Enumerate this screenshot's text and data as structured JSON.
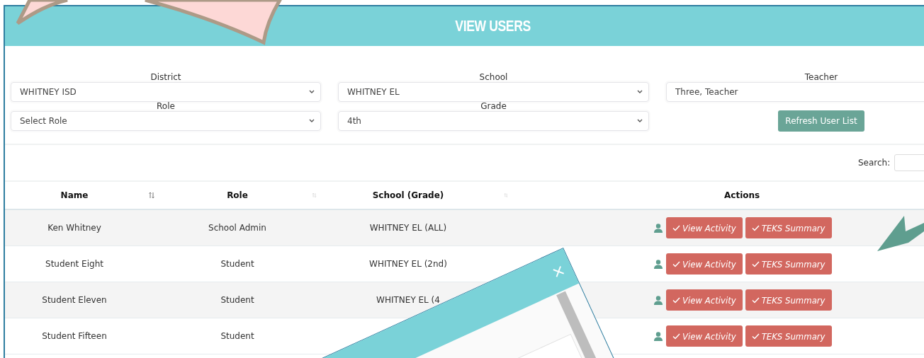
{
  "header": {
    "title": "VIEW USERS"
  },
  "filters": [
    {
      "label": "District",
      "value": "WHITNEY ISD",
      "kind": "select"
    },
    {
      "label": "School",
      "value": "WHITNEY EL",
      "kind": "select"
    },
    {
      "label": "Teacher",
      "value": "Three, Teacher",
      "kind": "text"
    },
    {
      "label": "Role",
      "value": "Select Role",
      "kind": "select"
    },
    {
      "label": "Grade",
      "value": "4th",
      "kind": "select"
    }
  ],
  "refresh_button": "Refresh User List",
  "search": {
    "label": "Search:"
  },
  "table": {
    "columns": [
      {
        "label": "Name",
        "sortable": true
      },
      {
        "label": "Role",
        "sortable": true
      },
      {
        "label": "School (Grade)",
        "sortable": true
      },
      {
        "label": "Actions",
        "sortable": false
      }
    ],
    "rows": [
      {
        "name": "Ken Whitney",
        "role": "School Admin",
        "school": "WHITNEY EL (ALL)",
        "actions": [
          "View Activity",
          "TEKS Summary"
        ]
      },
      {
        "name": "Student Eight",
        "role": "Student",
        "school": "WHITNEY EL (2nd)",
        "actions": [
          "View Activity",
          "TEKS Summary"
        ]
      },
      {
        "name": "Student Eleven",
        "role": "Student",
        "school": "WHITNEY EL (4",
        "actions": [
          "View Activity",
          "TEKS Summary"
        ]
      },
      {
        "name": "Student Fifteen",
        "role": "Student",
        "actions": [
          "View Activity",
          "TEKS Summary"
        ]
      }
    ]
  },
  "popup": {
    "close": "×"
  }
}
